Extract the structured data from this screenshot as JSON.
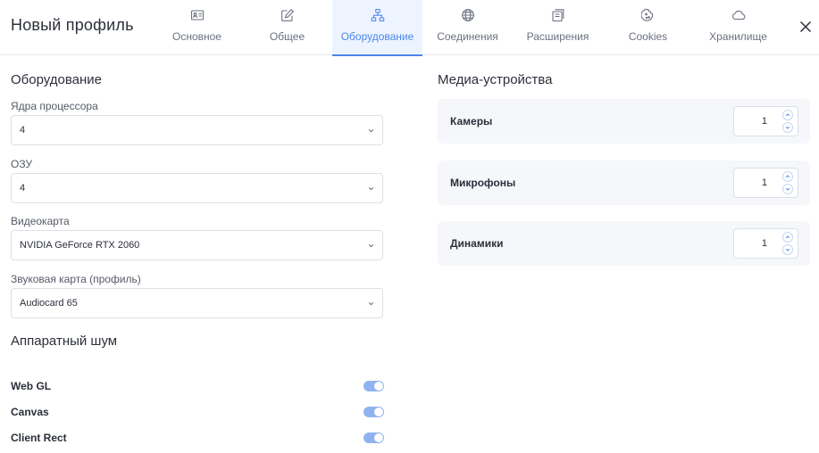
{
  "header": {
    "title": "Новый профиль",
    "tabs": [
      {
        "label": "Основное",
        "icon": "id-card-icon"
      },
      {
        "label": "Общее",
        "icon": "edit-icon"
      },
      {
        "label": "Оборудование",
        "icon": "hierarchy-icon",
        "active": true
      },
      {
        "label": "Соединения",
        "icon": "globe-icon"
      },
      {
        "label": "Расширения",
        "icon": "extension-icon"
      },
      {
        "label": "Cookies",
        "icon": "cookie-icon"
      },
      {
        "label": "Хранилище",
        "icon": "cloud-icon"
      }
    ],
    "close_icon": "close-icon"
  },
  "hardware": {
    "title": "Оборудование",
    "fields": [
      {
        "label": "Ядра процессора",
        "value": "4"
      },
      {
        "label": "ОЗУ",
        "value": "4"
      },
      {
        "label": "Видеокарта",
        "value": "NVIDIA GeForce RTX 2060"
      },
      {
        "label": "Звуковая карта (профиль)",
        "value": "Audiocard 65"
      }
    ]
  },
  "noise": {
    "title": "Аппаратный шум",
    "toggles": [
      {
        "label": "Web GL",
        "on": true
      },
      {
        "label": "Canvas",
        "on": true
      },
      {
        "label": "Client Rect",
        "on": true
      }
    ]
  },
  "media": {
    "title": "Медиа-устройства",
    "devices": [
      {
        "label": "Камеры",
        "value": "1"
      },
      {
        "label": "Микрофоны",
        "value": "1"
      },
      {
        "label": "Динамики",
        "value": "1"
      }
    ]
  },
  "colors": {
    "accent": "#4a86e8",
    "active_tab_bg": "#eef4ff",
    "toggle_on": "#8fb3ee",
    "card_bg": "#f5f7fb"
  }
}
